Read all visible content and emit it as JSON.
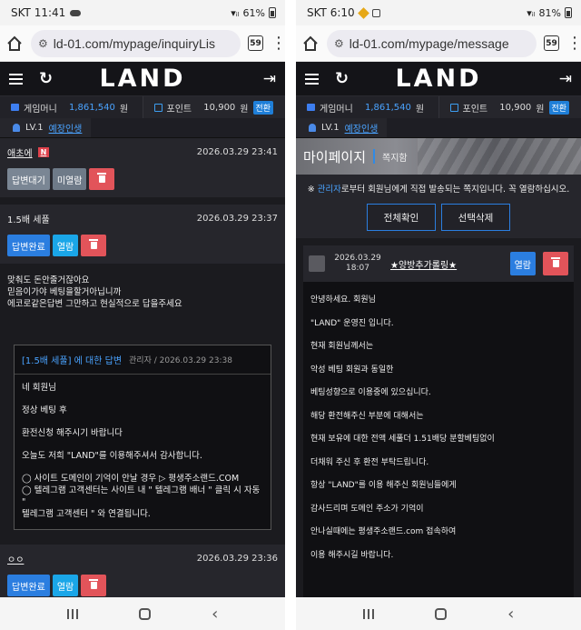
{
  "left": {
    "status": {
      "carrier_time": "SKT 11:41",
      "battery": "61%"
    },
    "url": "ld-01.com/mypage/inquiryLis",
    "tab_count": "59",
    "logo": "LAND",
    "money": {
      "game_label": "게임머니",
      "game_value": "1,861,540",
      "won": "원",
      "point_label": "포인트",
      "point_value": "10,900",
      "convert": "전환"
    },
    "level": {
      "lv": "LV.1",
      "grade": "예장인생"
    },
    "posts": [
      {
        "title": "애초에",
        "badge": "N",
        "date": "2026.03.29 23:41",
        "btn1": "답변대기",
        "btn2": "미열람"
      },
      {
        "title": "1.5배 세풀",
        "date": "2026.03.29 23:37",
        "btn1": "답변완료",
        "btn2": "열람"
      }
    ],
    "question_lines": [
      "맞춰도 돈안줄거잖아요",
      "믿음이가야 베팅을할거아닙니까",
      "에코로같은답변 그만하고 현실적으로 답을주세요"
    ],
    "answer": {
      "title": "[1.5배 세풀] 에 대한 답변",
      "meta": "관리자 / 2026.03.29 23:38",
      "lines": [
        "네 회원님",
        "정상 베팅 후",
        "환전신청 해주시기 바랍니다",
        "오늘도 저희 \"LAND\"를 이용해주셔서 감사합니다."
      ],
      "bullets": [
        "◯ 사이트 도메인이 기억이 안날 경우 ▷ 평생주소랜드.COM",
        "◯ 텔레그램 고객센터는 사이트 내 \" 텔레그램 배너 \" 클릭 시 자동 \"",
        "텔레그램 고객센터 \" 와 연결됩니다."
      ]
    },
    "post3": {
      "title": "ㅇㅇ",
      "date": "2026.03.29 23:36",
      "btn1": "답변완료",
      "btn2": "열람"
    }
  },
  "right": {
    "status": {
      "carrier_time": "SKT 6:10",
      "battery": "81%"
    },
    "url": "ld-01.com/mypage/message",
    "tab_count": "59",
    "logo": "LAND",
    "money": {
      "game_label": "게임머니",
      "game_value": "1,861,540",
      "won": "원",
      "point_label": "포인트",
      "point_value": "10,900",
      "convert": "전환"
    },
    "level": {
      "lv": "LV.1",
      "grade": "예장인생"
    },
    "banner": {
      "title": "마이페이지",
      "sub": "쪽지함"
    },
    "notice": {
      "prefix": "※ ",
      "highlight": "관리자",
      "rest": "로부터 회원님에게 직접 발송되는 쪽지입니다. 꼭 열람하십시오."
    },
    "check_all": "전체확인",
    "delete_selected": "선택삭제",
    "message": {
      "date": "2026.03.29",
      "time": "18:07",
      "title": "★양방추가롤링★",
      "read_btn": "열람",
      "lines": [
        "안녕하세요. 회원님",
        "\"LAND\" 운영진 입니다.",
        "현재 회원님께서는",
        "악성 베팅 회원과 동일한",
        "베팅성향으로 이용중에 있으십니다.",
        "해당 환전해주신 부분에 대해서는",
        "현재 보유에 대한 전액 세풀더 1.51배당 분할베팅없이",
        "더채워 주신 후 환전 부탁드립니다.",
        "항상 \"LAND\"를 이용 해주신 회원님들에게",
        "감사드리며 도메인 주소가 기억이",
        "안나실때에는 평생주소랜드.com 접속하여",
        "이용 해주시길 바랍니다."
      ]
    }
  }
}
